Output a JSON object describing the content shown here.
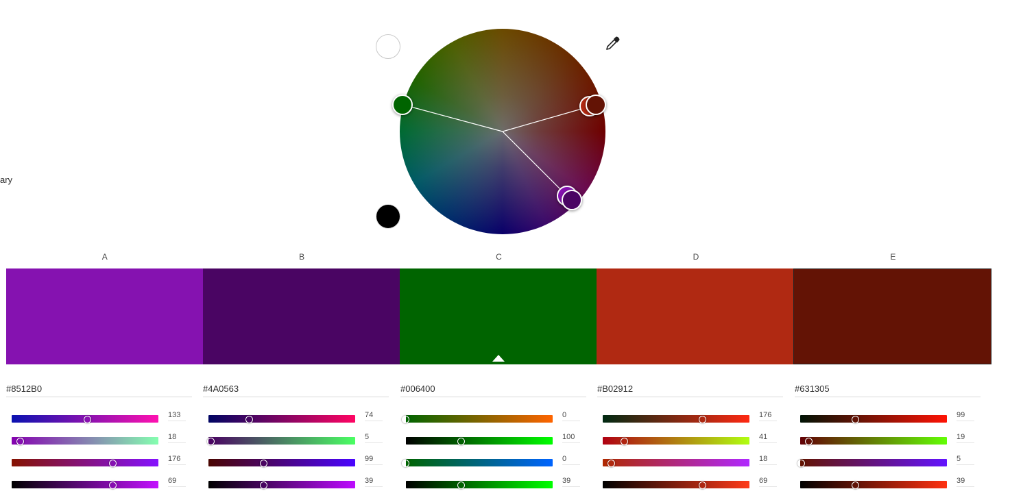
{
  "side_label": "ary",
  "wheel": {
    "handle_colors": [
      "#006400",
      "#631305",
      "#B02912",
      "#8512B0",
      "#4A0563"
    ]
  },
  "icons": {
    "brightness_white": "circle-white",
    "brightness_black": "circle-black",
    "eyedropper": "eyedropper-icon"
  },
  "swatches": [
    {
      "label": "A",
      "hex": "#8512B0",
      "color": "#8512B0",
      "values": [
        "133",
        "18",
        "176",
        "69"
      ],
      "levels": [
        0.52,
        0.06,
        0.69,
        0.69
      ]
    },
    {
      "label": "B",
      "hex": "#4A0563",
      "color": "#4A0563",
      "values": [
        "74",
        "5",
        "99",
        "39"
      ],
      "levels": [
        0.28,
        0.02,
        0.38,
        0.38
      ]
    },
    {
      "label": "C",
      "hex": "#006400",
      "color": "#006400",
      "values": [
        "0",
        "100",
        "0",
        "39"
      ],
      "levels": [
        0,
        0.38,
        0,
        0.38
      ]
    },
    {
      "label": "D",
      "hex": "#B02912",
      "color": "#B02912",
      "values": [
        "176",
        "41",
        "18",
        "69"
      ],
      "levels": [
        0.68,
        0.15,
        0.06,
        0.68
      ]
    },
    {
      "label": "E",
      "hex": "#631305",
      "color": "#631305",
      "values": [
        "99",
        "19",
        "5",
        "39"
      ],
      "levels": [
        0.38,
        0.06,
        0.01,
        0.38
      ]
    }
  ],
  "active_swatch": "C",
  "track_gradients": [
    [
      "linear-gradient(90deg,#0a12b0,#ff12b0)",
      "linear-gradient(90deg,#8500b0,#85ffb0)",
      "linear-gradient(90deg,#851200,#8512ff)",
      "linear-gradient(90deg,#000,#c312ff)"
    ],
    [
      "linear-gradient(90deg,#000563,#ff0563)",
      "linear-gradient(90deg,#4a0063,#4aff63)",
      "linear-gradient(90deg,#4a0500,#4a05ff)",
      "linear-gradient(90deg,#000,#bd0cff)"
    ],
    [
      "linear-gradient(90deg,#006400,#ff6400)",
      "linear-gradient(90deg,#000,#00ff00)",
      "linear-gradient(90deg,#006400,#0064ff)",
      "linear-gradient(90deg,#000,#00ff00)"
    ],
    [
      "linear-gradient(90deg,#002912,#ff2912)",
      "linear-gradient(90deg,#b00012,#b0ff12)",
      "linear-gradient(90deg,#b02900,#b029ff)",
      "linear-gradient(90deg,#000,#ff3b1a)"
    ],
    [
      "linear-gradient(90deg,#001305,#ff1305)",
      "linear-gradient(90deg,#630005,#63ff05)",
      "linear-gradient(90deg,#631300,#6313ff)",
      "linear-gradient(90deg,#000,#ff3110)"
    ]
  ]
}
